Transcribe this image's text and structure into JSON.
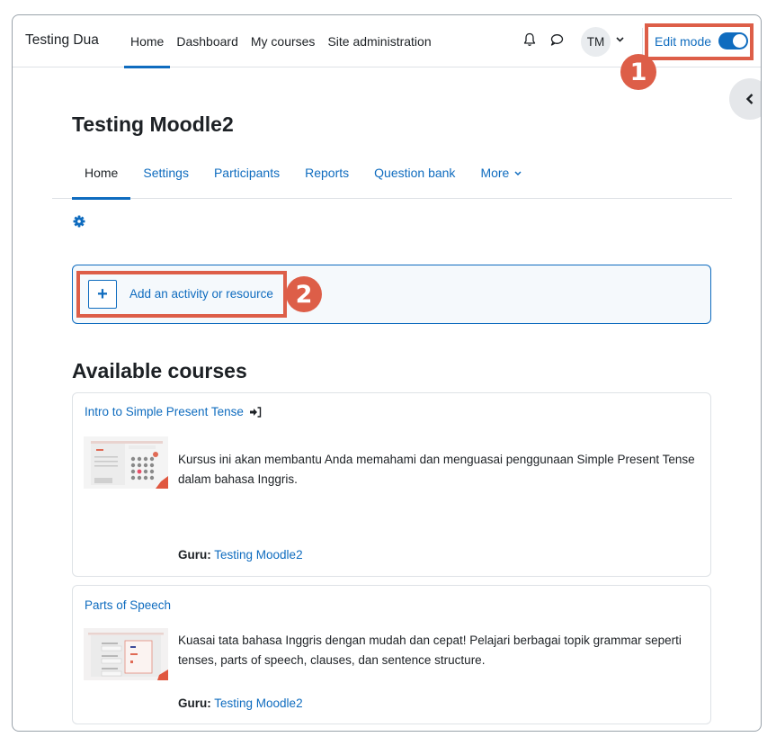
{
  "navbar": {
    "site_name": "Testing Dua",
    "primary_nav": [
      {
        "label": "Home",
        "active": true
      },
      {
        "label": "Dashboard",
        "active": false
      },
      {
        "label": "My courses",
        "active": false
      },
      {
        "label": "Site administration",
        "active": false
      }
    ],
    "icons": [
      "bell-icon",
      "chat-icon"
    ],
    "user_initials": "TM",
    "edit_mode_label": "Edit mode",
    "edit_mode_on": true
  },
  "annotations": {
    "badge_1": "1",
    "badge_2": "2",
    "color": "#dd5e48"
  },
  "course": {
    "title": "Testing Moodle2",
    "tabs": [
      {
        "label": "Home",
        "active": true
      },
      {
        "label": "Settings",
        "active": false
      },
      {
        "label": "Participants",
        "active": false
      },
      {
        "label": "Reports",
        "active": false
      },
      {
        "label": "Question bank",
        "active": false
      },
      {
        "label": "More",
        "active": false,
        "has_caret": true
      }
    ],
    "add_activity_label": "Add an activity or resource"
  },
  "available_courses": {
    "heading": "Available courses",
    "items": [
      {
        "name": "Intro to Simple Present Tense",
        "has_enrol_icon": true,
        "summary": "Kursus ini akan membantu Anda memahami dan menguasai penggunaan Simple Present Tense dalam bahasa Inggris.",
        "teacher_role": "Guru:",
        "teacher_name": "Testing Moodle2"
      },
      {
        "name": "Parts of Speech",
        "has_enrol_icon": false,
        "summary": "Kuasai tata bahasa Inggris dengan mudah dan cepat! Pelajari berbagai topik grammar seperti tenses, parts of speech, clauses, dan sentence structure.",
        "teacher_role": "Guru:",
        "teacher_name": "Testing Moodle2"
      }
    ]
  },
  "colors": {
    "primary": "#0f6cbf",
    "text": "#1d2125",
    "annotation": "#dd5e48"
  }
}
